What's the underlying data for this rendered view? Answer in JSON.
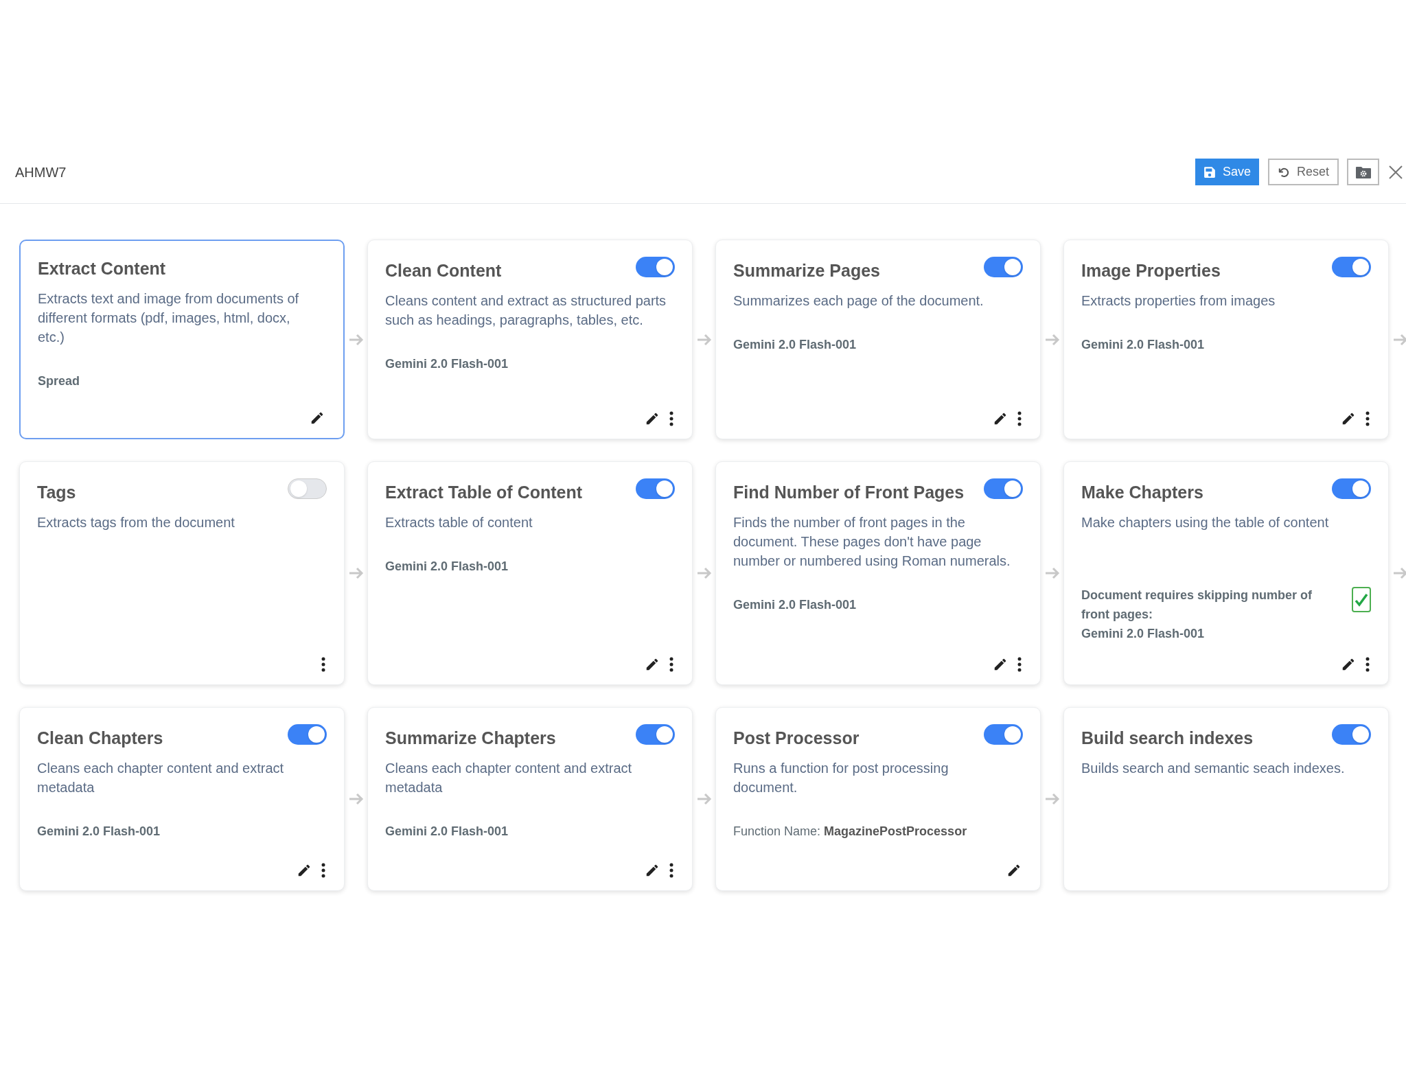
{
  "header": {
    "title": "AHMW7",
    "buttons": [
      {
        "kind": "save",
        "label": "Save"
      },
      {
        "kind": "reset",
        "label": "Reset"
      },
      {
        "kind": "folder"
      },
      {
        "kind": "close"
      }
    ]
  },
  "rows": [
    {
      "cards": [
        {
          "title": "Extract Content",
          "selected": true,
          "description": "Extracts text and image from documents of different formats (pdf, images, html, docx, etc.)",
          "detail": "Spread",
          "actions": [
            {
              "kind": "edit"
            }
          ],
          "arrow_after": true
        },
        {
          "title": "Clean Content",
          "selected": false,
          "toggle": {
            "on": true
          },
          "description": "Cleans content and extract as structured parts such as headings, paragraphs, tables, etc.",
          "detail": "Gemini 2.0 Flash-001",
          "actions": [
            {
              "kind": "edit"
            },
            {
              "kind": "more"
            }
          ],
          "arrow_after": true
        },
        {
          "title": "Summarize Pages",
          "selected": false,
          "toggle": {
            "on": true
          },
          "description": "Summarizes each page of the document.",
          "detail": "Gemini 2.0 Flash-001",
          "actions": [
            {
              "kind": "edit"
            },
            {
              "kind": "more"
            }
          ],
          "arrow_after": true
        },
        {
          "title": "Image Properties",
          "selected": false,
          "toggle": {
            "on": true
          },
          "description": "Extracts properties from images",
          "detail": "Gemini 2.0 Flash-001",
          "actions": [
            {
              "kind": "edit"
            },
            {
              "kind": "more"
            }
          ],
          "arrow_after": true
        }
      ]
    },
    {
      "cards": [
        {
          "title": "Tags",
          "selected": false,
          "toggle": {
            "on": false
          },
          "description": "Extracts tags from the document",
          "actions": [
            {
              "kind": "more"
            }
          ],
          "arrow_after": true
        },
        {
          "title": "Extract Table of Content",
          "selected": false,
          "toggle": {
            "on": true
          },
          "description": "Extracts table of content",
          "detail": "Gemini 2.0 Flash-001",
          "actions": [
            {
              "kind": "edit"
            },
            {
              "kind": "more"
            }
          ],
          "arrow_after": true
        },
        {
          "title": "Find Number of Front Pages",
          "selected": false,
          "toggle": {
            "on": true
          },
          "description": "Finds the number of front pages in the document. These pages don't have page number or numbered using Roman numerals.",
          "detail": "Gemini 2.0 Flash-001",
          "actions": [
            {
              "kind": "edit"
            },
            {
              "kind": "more"
            }
          ],
          "arrow_after": true
        },
        {
          "title": "Make Chapters",
          "selected": false,
          "toggle": {
            "on": true
          },
          "description": "Make chapters using the table of content",
          "checkbox": {
            "label": "Document requires skipping number of front pages:",
            "checked": true
          },
          "detail": "Gemini 2.0 Flash-001",
          "actions": [
            {
              "kind": "edit"
            },
            {
              "kind": "more"
            }
          ],
          "arrow_after": true
        }
      ]
    },
    {
      "cards": [
        {
          "title": "Clean Chapters",
          "selected": false,
          "toggle": {
            "on": true
          },
          "description": "Cleans each chapter content and extract metadata",
          "detail": "Gemini 2.0 Flash-001",
          "actions": [
            {
              "kind": "edit"
            },
            {
              "kind": "more"
            }
          ],
          "arrow_after": true
        },
        {
          "title": "Summarize Chapters",
          "selected": false,
          "toggle": {
            "on": true
          },
          "description": "Cleans each chapter content and extract metadata",
          "detail": "Gemini 2.0 Flash-001",
          "actions": [
            {
              "kind": "edit"
            },
            {
              "kind": "more"
            }
          ],
          "arrow_after": true
        },
        {
          "title": "Post Processor",
          "selected": false,
          "toggle": {
            "on": true
          },
          "description": "Runs a function for post processing document.",
          "detail": "Function Name: **MagazinePostProcessor**",
          "detail_plain": true,
          "actions": [
            {
              "kind": "edit"
            }
          ],
          "arrow_after": true
        },
        {
          "title": "Build search indexes",
          "selected": false,
          "toggle": {
            "on": true
          },
          "description": "Builds search and semantic seach indexes.",
          "arrow_after": false
        }
      ]
    }
  ]
}
